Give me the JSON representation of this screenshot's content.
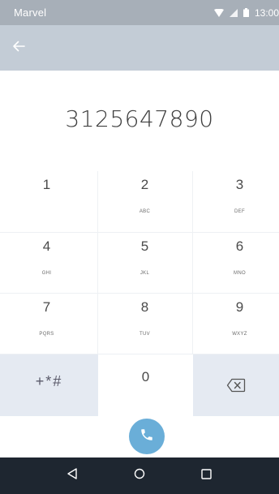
{
  "status_bar": {
    "carrier": "Marvel",
    "time": "13:00",
    "icons": [
      "wifi-icon",
      "signal-icon",
      "battery-icon"
    ]
  },
  "app_bar": {
    "back_icon": "arrow-left-icon"
  },
  "dial": {
    "number": "3125647890"
  },
  "keypad": {
    "keys": [
      {
        "digit": "1",
        "letters": ""
      },
      {
        "digit": "2",
        "letters": "ABC"
      },
      {
        "digit": "3",
        "letters": "DEF"
      },
      {
        "digit": "4",
        "letters": "GHI"
      },
      {
        "digit": "5",
        "letters": "JKL"
      },
      {
        "digit": "6",
        "letters": "MNO"
      },
      {
        "digit": "7",
        "letters": "PQRS"
      },
      {
        "digit": "8",
        "letters": "TUV"
      },
      {
        "digit": "9",
        "letters": "WXYZ"
      }
    ],
    "symbols_label": "+*#",
    "zero": "0",
    "delete_icon": "backspace-icon"
  },
  "call": {
    "icon": "phone-icon"
  },
  "nav": {
    "icons": [
      "back-triangle-icon",
      "home-circle-icon",
      "recents-square-icon"
    ]
  },
  "colors": {
    "status_bar": "#a7afb8",
    "app_bar": "#c3ccd6",
    "special_key": "#e5eaf2",
    "call_button": "#6aaed8",
    "nav_bar": "#1e2630"
  }
}
